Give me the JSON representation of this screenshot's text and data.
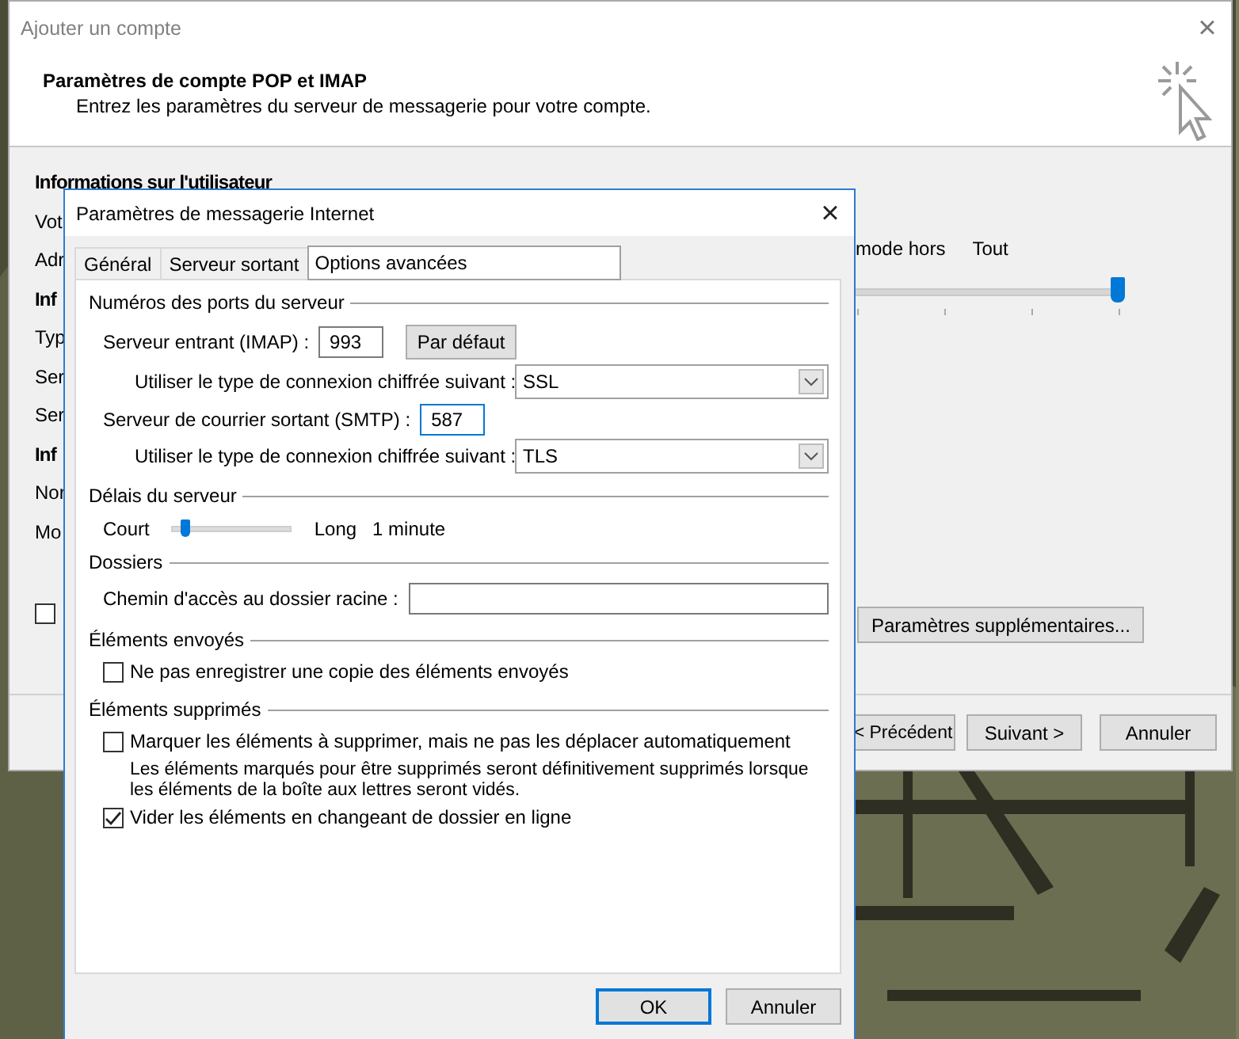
{
  "back_window": {
    "title": "Ajouter un compte",
    "close": "×",
    "header_title": "Paramètres de compte POP et IMAP",
    "header_subtitle": "Entrez les paramètres du serveur de messagerie pour votre compte.",
    "left_labels": [
      {
        "text": "Informations sur l'utilisateur",
        "kind": "heading"
      },
      {
        "text": "Vot",
        "kind": "label"
      },
      {
        "text": "Adr",
        "kind": "label"
      },
      {
        "text": "Inf",
        "kind": "heading"
      },
      {
        "text": "Typ",
        "kind": "label"
      },
      {
        "text": "Ser",
        "kind": "label"
      },
      {
        "text": "Ser",
        "kind": "label"
      },
      {
        "text": "Inf",
        "kind": "heading"
      },
      {
        "text": "Nor",
        "kind": "label"
      },
      {
        "text": "Mo",
        "kind": "label"
      }
    ],
    "checkbox": {
      "checked": false
    },
    "offline_label": "mode hors",
    "offline_value": "Tout",
    "offline_slider": {
      "level": 1
    },
    "more_settings_button": "Paramètres supplémentaires...",
    "buttons": [
      "< Précédent",
      "Suivant >",
      "Annuler"
    ]
  },
  "dialog": {
    "title": "Paramètres de messagerie Internet",
    "close": "×",
    "tabs": [
      {
        "label": "Général",
        "selected": false
      },
      {
        "label": "Serveur sortant",
        "selected": false
      },
      {
        "label": "Options avancées",
        "selected": true
      }
    ],
    "ports": {
      "title": "Numéros des ports du serveur",
      "incoming_label": "Serveur entrant (IMAP) :",
      "incoming_port": "993",
      "default_button": "Par défaut",
      "incoming_encryption_label": "Utiliser le type de connexion chiffrée suivant :",
      "incoming_encryption": "SSL",
      "outgoing_label": "Serveur de courrier sortant (SMTP) :",
      "outgoing_port": "587",
      "outgoing_focused": true,
      "outgoing_encryption_label": "Utiliser le type de connexion chiffrée suivant :",
      "outgoing_encryption": "TLS"
    },
    "timeout": {
      "title": "Délais du serveur",
      "short_label": "Court",
      "long_label": "Long",
      "level": 0.1,
      "value": "1 minute"
    },
    "folders": {
      "title": "Dossiers",
      "root_label": "Chemin d'accès au dossier racine :"
    },
    "sent": {
      "title": "Éléments envoyés",
      "option": {
        "label": "Ne pas enregistrer une copie des éléments envoyés",
        "checked": false
      }
    },
    "deleted": {
      "title": "Éléments supprimés",
      "options": [
        {
          "label": "Marquer les éléments à supprimer, mais ne pas les déplacer automatiquement",
          "checked": false,
          "note": "Les éléments marqués pour être supprimés seront définitivement supprimés lorsque les éléments de la boîte aux lettres seront vidés."
        },
        {
          "label": "Vider les éléments en changeant de dossier en ligne",
          "checked": true
        }
      ]
    },
    "buttons": [
      {
        "label": "OK",
        "default": true
      },
      {
        "label": "Annuler",
        "default": false
      }
    ]
  }
}
